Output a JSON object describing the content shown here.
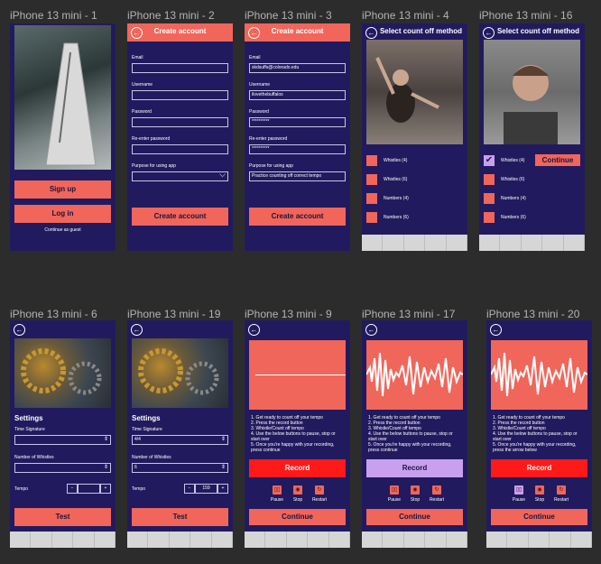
{
  "frames": {
    "f1": "iPhone 13 mini - 1",
    "f2": "iPhone 13 mini - 2",
    "f3": "iPhone 13 mini - 3",
    "f4": "iPhone 13 mini - 4",
    "f16": "iPhone 13 mini - 16",
    "f6": "iPhone 13 mini - 6",
    "f19": "iPhone 13 mini - 19",
    "f9": "iPhone 13 mini - 9",
    "f17": "iPhone 13 mini - 17",
    "f20": "iPhone 13 mini - 20"
  },
  "welcome": {
    "signup": "Sign up",
    "login": "Log in",
    "guest": "Continue as guest"
  },
  "create": {
    "title": "Create account",
    "email_label": "Email",
    "username_label": "Username",
    "password_label": "Password",
    "reenter_label": "Re-enter password",
    "purpose_label": "Purpose for using app",
    "submit": "Create account",
    "filled_email": "skdsuffs@colorado.edu",
    "filled_username": "ilovethebuffalos",
    "filled_password": "**********",
    "filled_reenter": "**********",
    "filled_purpose": "Practice counting off correct tempo"
  },
  "countoff": {
    "title": "Select count off method",
    "options": [
      "Whistles (4)",
      "Whistles (6)",
      "Numbers (4)",
      "Numbers (6)"
    ],
    "continue": "Continue"
  },
  "settings": {
    "title": "Settings",
    "time_sig_label": "Time Signature",
    "whistles_label": "Number of Whistles",
    "tempo_label": "Tempo",
    "minus": "−",
    "plus": "+",
    "test": "Test",
    "filled_time_sig": "4/4",
    "filled_whistles": "6",
    "filled_tempo": "159"
  },
  "record": {
    "instructions": [
      "1. Get ready to count off your tempo",
      "2. Press the record button",
      "3. Whistle/Count off tempo",
      "4. Use the below buttons to pause, stop or",
      "   start over",
      "5. Once you're happy with your recording,",
      "   press continue"
    ],
    "instructions_alt": [
      "1. Get ready to count off your tempo",
      "2. Press the record button",
      "3. Whistle/Count off tempo",
      "4. Use the below buttons to pause, stop or",
      "   start over",
      "5. Once you're happy with your recording,",
      "   press the arrow below"
    ],
    "record": "Record",
    "pause": "Pause",
    "stop": "Stop",
    "restart": "Restart",
    "continue": "Continue"
  },
  "colors": {
    "screen_bg": "#221a5e",
    "accent": "#f0665a",
    "record_red": "#ff1a1a",
    "lavender": "#c9a0f0",
    "canvas": "#2c2c2c"
  }
}
